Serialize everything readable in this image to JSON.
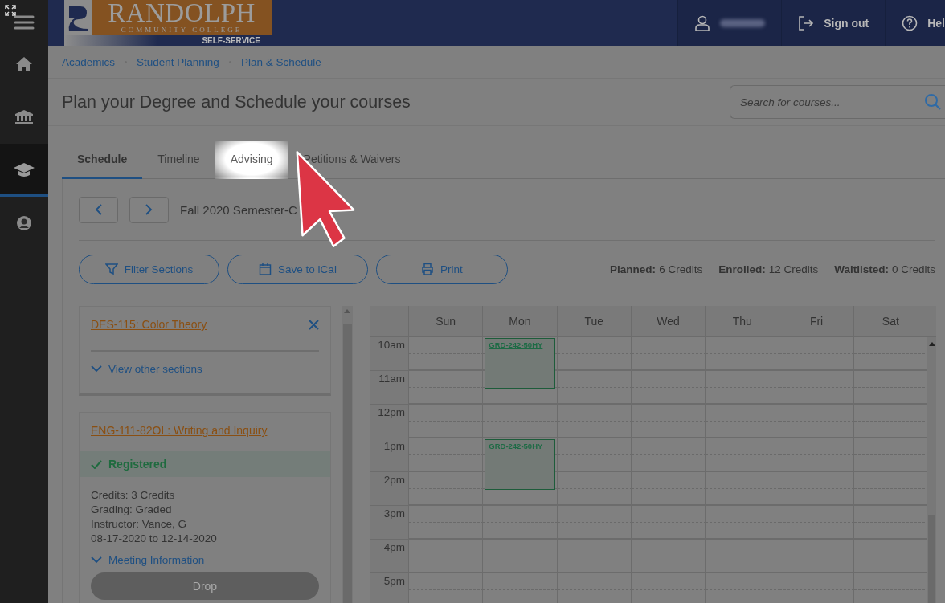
{
  "logo": {
    "name": "RANDOLPH",
    "subtitle": "COMMUNITY COLLEGE",
    "tag": "SELF-SERVICE"
  },
  "header": {
    "sign_out": "Sign out",
    "help": "Hel"
  },
  "sidebar": {
    "items": [
      {
        "kind": "home",
        "selected": false
      },
      {
        "kind": "bank",
        "selected": false
      },
      {
        "kind": "cap",
        "selected": true
      },
      {
        "kind": "user",
        "selected": false
      }
    ]
  },
  "breadcrumbs": [
    {
      "label": "Academics",
      "link": true
    },
    {
      "label": "Student Planning",
      "link": true
    },
    {
      "label": "Plan & Schedule",
      "link": false
    }
  ],
  "title": "Plan your Degree and Schedule your courses",
  "search": {
    "placeholder": "Search for courses..."
  },
  "tabs": [
    {
      "label": "Schedule",
      "selected": true,
      "highlighted": false
    },
    {
      "label": "Timeline",
      "selected": false,
      "highlighted": false
    },
    {
      "label": "Advising",
      "selected": false,
      "highlighted": true
    },
    {
      "label": "Petitions & Waivers",
      "selected": false,
      "highlighted": false
    }
  ],
  "term": "Fall 2020 Semester-C",
  "actions": [
    {
      "kind": "filter",
      "label": "Filter Sections"
    },
    {
      "kind": "calendar",
      "label": "Save to iCal"
    },
    {
      "kind": "print",
      "label": "Print"
    }
  ],
  "credits": [
    {
      "label": "Planned:",
      "value": "6 Credits"
    },
    {
      "label": "Enrolled:",
      "value": "12 Credits"
    },
    {
      "label": "Waitlisted:",
      "value": "0 Credits"
    }
  ],
  "courses": [
    {
      "title": "DES-115: Color Theory",
      "removable": true,
      "toggle": "View other sections"
    },
    {
      "title": "ENG-111-82OL: Writing and Inquiry",
      "removable": false,
      "status": "Registered",
      "details": [
        "Credits: 3 Credits",
        "Grading: Graded",
        "Instructor: Vance, G",
        "08-17-2020 to 12-14-2020"
      ],
      "toggle": "Meeting Information",
      "button": {
        "label": "Drop",
        "disabled": true
      }
    }
  ],
  "calendar": {
    "days": [
      "Sun",
      "Mon",
      "Tue",
      "Wed",
      "Thu",
      "Fri",
      "Sat"
    ],
    "rows": [
      {
        "time": "10am",
        "cells": [
          {
            "kind": "empty"
          },
          {
            "kind": "event",
            "label": "GRD-242-50HY"
          },
          {
            "kind": "empty"
          },
          {
            "kind": "empty"
          },
          {
            "kind": "empty"
          },
          {
            "kind": "empty"
          },
          {
            "kind": "empty"
          }
        ]
      },
      {
        "time": "11am",
        "cells": []
      },
      {
        "time": "12pm",
        "cells": []
      },
      {
        "time": "1pm",
        "cells": [
          {
            "kind": "empty"
          },
          {
            "kind": "event",
            "label": "GRD-242-50HY"
          },
          {
            "kind": "empty"
          },
          {
            "kind": "empty"
          },
          {
            "kind": "empty"
          },
          {
            "kind": "empty"
          },
          {
            "kind": "empty"
          }
        ]
      },
      {
        "time": "2pm",
        "cells": []
      },
      {
        "time": "3pm",
        "cells": []
      },
      {
        "time": "4pm",
        "cells": []
      },
      {
        "time": "5pm",
        "cells": []
      }
    ]
  }
}
